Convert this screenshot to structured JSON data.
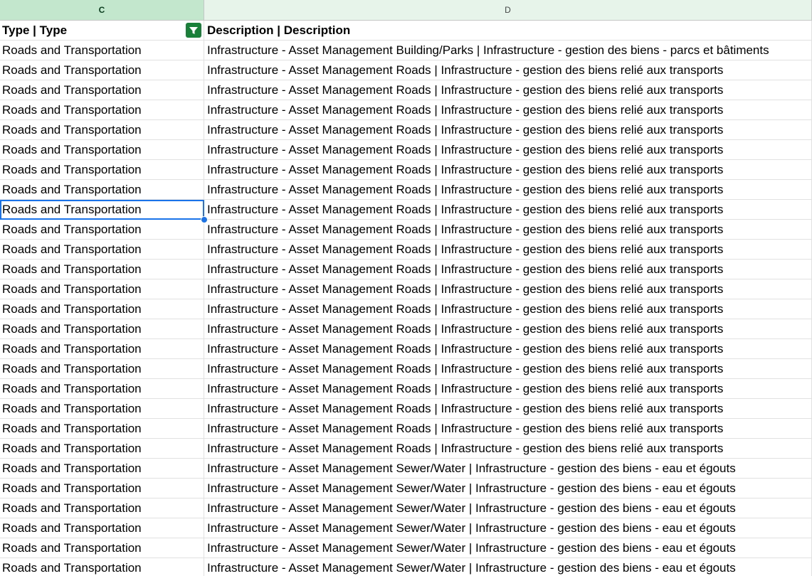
{
  "columns": {
    "c": "C",
    "d": "D"
  },
  "header": {
    "type": "Type | Type",
    "description": "Description | Description"
  },
  "filter_icon": "filter-icon",
  "rows": [
    {
      "type": "Roads and Transportation",
      "description": "Infrastructure - Asset Management Building/Parks | Infrastructure - gestion des biens - parcs et bâtiments"
    },
    {
      "type": "Roads and Transportation",
      "description": "Infrastructure - Asset Management Roads | Infrastructure - gestion des biens relié aux transports"
    },
    {
      "type": "Roads and Transportation",
      "description": "Infrastructure - Asset Management Roads | Infrastructure - gestion des biens relié aux transports"
    },
    {
      "type": "Roads and Transportation",
      "description": "Infrastructure - Asset Management Roads | Infrastructure - gestion des biens relié aux transports"
    },
    {
      "type": "Roads and Transportation",
      "description": "Infrastructure - Asset Management Roads | Infrastructure - gestion des biens relié aux transports"
    },
    {
      "type": "Roads and Transportation",
      "description": "Infrastructure - Asset Management Roads | Infrastructure - gestion des biens relié aux transports"
    },
    {
      "type": "Roads and Transportation",
      "description": "Infrastructure - Asset Management Roads | Infrastructure - gestion des biens relié aux transports"
    },
    {
      "type": "Roads and Transportation",
      "description": "Infrastructure - Asset Management Roads | Infrastructure - gestion des biens relié aux transports"
    },
    {
      "type": "Roads and Transportation",
      "description": "Infrastructure - Asset Management Roads | Infrastructure - gestion des biens relié aux transports",
      "selected": true
    },
    {
      "type": "Roads and Transportation",
      "description": "Infrastructure - Asset Management Roads | Infrastructure - gestion des biens relié aux transports"
    },
    {
      "type": "Roads and Transportation",
      "description": "Infrastructure - Asset Management Roads | Infrastructure - gestion des biens relié aux transports"
    },
    {
      "type": "Roads and Transportation",
      "description": "Infrastructure - Asset Management Roads | Infrastructure - gestion des biens relié aux transports"
    },
    {
      "type": "Roads and Transportation",
      "description": "Infrastructure - Asset Management Roads | Infrastructure - gestion des biens relié aux transports"
    },
    {
      "type": "Roads and Transportation",
      "description": "Infrastructure - Asset Management Roads | Infrastructure - gestion des biens relié aux transports"
    },
    {
      "type": "Roads and Transportation",
      "description": "Infrastructure - Asset Management Roads | Infrastructure - gestion des biens relié aux transports"
    },
    {
      "type": "Roads and Transportation",
      "description": "Infrastructure - Asset Management Roads | Infrastructure - gestion des biens relié aux transports"
    },
    {
      "type": "Roads and Transportation",
      "description": "Infrastructure - Asset Management Roads | Infrastructure - gestion des biens relié aux transports"
    },
    {
      "type": "Roads and Transportation",
      "description": "Infrastructure - Asset Management Roads | Infrastructure - gestion des biens relié aux transports"
    },
    {
      "type": "Roads and Transportation",
      "description": "Infrastructure - Asset Management Roads | Infrastructure - gestion des biens relié aux transports"
    },
    {
      "type": "Roads and Transportation",
      "description": "Infrastructure - Asset Management Roads | Infrastructure - gestion des biens relié aux transports"
    },
    {
      "type": "Roads and Transportation",
      "description": "Infrastructure - Asset Management Roads | Infrastructure - gestion des biens relié aux transports"
    },
    {
      "type": "Roads and Transportation",
      "description": "Infrastructure - Asset Management Sewer/Water | Infrastructure - gestion des biens - eau et égouts"
    },
    {
      "type": "Roads and Transportation",
      "description": "Infrastructure - Asset Management Sewer/Water | Infrastructure - gestion des biens - eau et égouts"
    },
    {
      "type": "Roads and Transportation",
      "description": "Infrastructure - Asset Management Sewer/Water | Infrastructure - gestion des biens - eau et égouts"
    },
    {
      "type": "Roads and Transportation",
      "description": "Infrastructure - Asset Management Sewer/Water | Infrastructure - gestion des biens - eau et égouts"
    },
    {
      "type": "Roads and Transportation",
      "description": "Infrastructure - Asset Management Sewer/Water | Infrastructure - gestion des biens - eau et égouts"
    },
    {
      "type": "Roads and Transportation",
      "description": "Infrastructure - Asset Management Sewer/Water | Infrastructure - gestion des biens - eau et égouts"
    }
  ],
  "colors": {
    "selection": "#1a73e8",
    "filter_active": "#188038",
    "selected_col_header": "#c2e7cc",
    "col_header": "#e6f4ea"
  }
}
